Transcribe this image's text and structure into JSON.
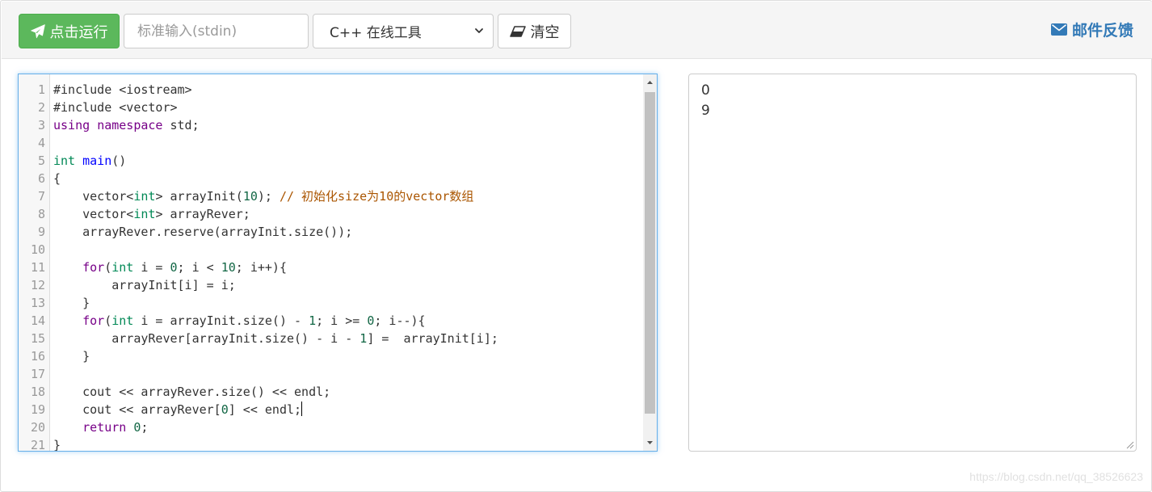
{
  "toolbar": {
    "run_label": "点击运行",
    "stdin_placeholder": "标准输入(stdin)",
    "language_selected": "C++ 在线工具",
    "clear_label": "清空",
    "feedback_label": "邮件反馈"
  },
  "editor": {
    "line_numbers": [
      "1",
      "2",
      "3",
      "4",
      "5",
      "6",
      "7",
      "8",
      "9",
      "10",
      "11",
      "12",
      "13",
      "14",
      "15",
      "16",
      "17",
      "18",
      "19",
      "20",
      "21"
    ],
    "lines": [
      "#include <iostream>",
      "#include <vector>",
      "using namespace std;",
      "",
      "int main()",
      "{",
      "    vector<int> arrayInit(10); // 初始化size为10的vector数组",
      "    vector<int> arrayRever;",
      "    arrayRever.reserve(arrayInit.size());",
      "",
      "    for(int i = 0; i < 10; i++){",
      "        arrayInit[i] = i;",
      "    }",
      "    for(int i = arrayInit.size() - 1; i >= 0; i--){",
      "        arrayRever[arrayInit.size() - i - 1] =  arrayInit[i];",
      "    }",
      "",
      "    cout << arrayRever.size() << endl;",
      "    cout << arrayRever[0] << endl;",
      "    return 0;",
      "}"
    ]
  },
  "output": {
    "lines": [
      "0",
      "9"
    ]
  },
  "watermark": "https://blog.csdn.net/qq_38526623",
  "colors": {
    "run_button": "#5cb85c",
    "feedback_link": "#337ab7",
    "keyword": "#770088",
    "type": "#008855",
    "definition": "#0000ff",
    "number": "#116644",
    "comment": "#aa5500"
  }
}
